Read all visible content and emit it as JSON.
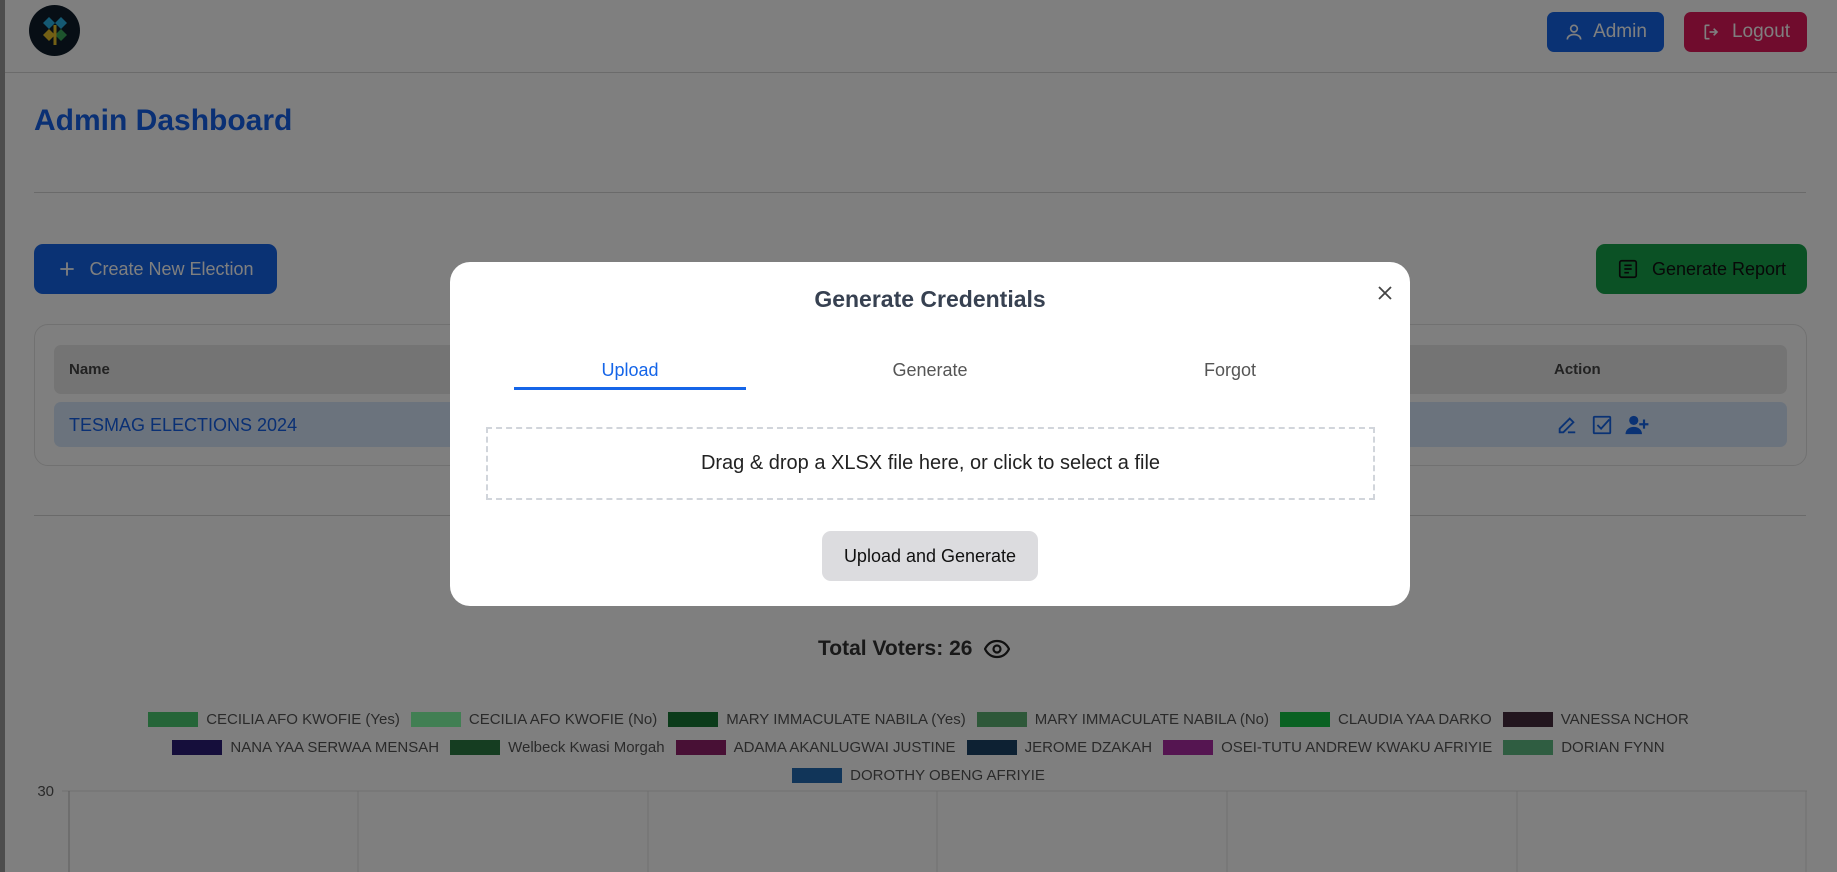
{
  "header": {
    "admin_label": "Admin",
    "logout_label": "Logout"
  },
  "page": {
    "title": "Admin Dashboard",
    "create_label": "Create New Election",
    "report_label": "Generate Report"
  },
  "table": {
    "headers": [
      "Name",
      "Action"
    ],
    "rows": [
      {
        "name": "TESMAG ELECTIONS 2024"
      }
    ]
  },
  "stats": {
    "total_voters": "Total Voters: 26"
  },
  "legend": {
    "items": [
      {
        "label": "CECILIA AFO KWOFIE (Yes)",
        "color": "#2e7f46"
      },
      {
        "label": "CECILIA AFO KWOFIE (No)",
        "color": "#52a368"
      },
      {
        "label": "MARY IMMACULATE NABILA (Yes)",
        "color": "#0e4a21"
      },
      {
        "label": "MARY IMMACULATE NABILA (No)",
        "color": "#3a6e47"
      },
      {
        "label": "CLAUDIA YAA DARKO",
        "color": "#0d7a2b"
      },
      {
        "label": "VANESSA NCHOR",
        "color": "#2b1a26"
      },
      {
        "label": "NANA YAA SERWAA MENSAH",
        "color": "#1a124a"
      },
      {
        "label": "Welbeck Kwasi Morgah",
        "color": "#1a4d2a"
      },
      {
        "label": "ADAMA AKANLUGWAI JUSTINE",
        "color": "#5a1443"
      },
      {
        "label": "JEROME DZAKAH",
        "color": "#112a40"
      },
      {
        "label": "OSEI-TUTU ANDREW KWAKU AFRIYIE",
        "color": "#6a1a66"
      },
      {
        "label": "DORIAN FYNN",
        "color": "#3b7551"
      },
      {
        "label": "DOROTHY OBENG AFRIYIE",
        "color": "#164270"
      }
    ]
  },
  "chart": {
    "y_tick_top": "30"
  },
  "modal": {
    "title": "Generate Credentials",
    "tabs": [
      "Upload",
      "Generate",
      "Forgot"
    ],
    "dropzone_text": "Drag & drop a XLSX file here, or click to select a file",
    "upload_button": "Upload and Generate"
  }
}
